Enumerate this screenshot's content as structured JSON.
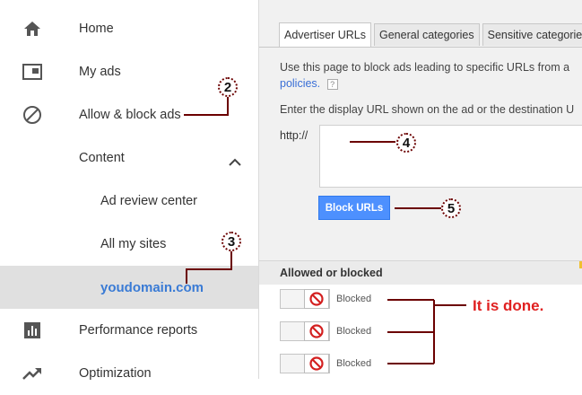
{
  "sidebar": {
    "items": [
      {
        "label": "Home",
        "icon": "home-icon"
      },
      {
        "label": "My ads",
        "icon": "ads-icon"
      },
      {
        "label": "Allow & block ads",
        "icon": "block-icon"
      },
      {
        "label": "Content",
        "icon": "chevron-up-icon"
      },
      {
        "label": "Ad review center"
      },
      {
        "label": "All my sites"
      },
      {
        "label": "youdomain.com"
      },
      {
        "label": "Performance reports",
        "icon": "bar-chart-icon"
      },
      {
        "label": "Optimization",
        "icon": "trending-up-icon"
      }
    ]
  },
  "main": {
    "tabs": [
      "Advertiser URLs",
      "General categories",
      "Sensitive categories"
    ],
    "description": "Use this page to block ads leading to specific URLs from a",
    "policies_link": "policies.",
    "help": "?",
    "instruction": "Enter the display URL shown on the ad or the destination U",
    "url_prefix": "http://",
    "block_button": "Block URLs",
    "table_header": "Allowed or blocked",
    "rows": [
      {
        "status": "Blocked"
      },
      {
        "status": "Blocked"
      },
      {
        "status": "Blocked"
      }
    ]
  },
  "annotations": {
    "markers": [
      "2",
      "3",
      "4",
      "5"
    ],
    "done_text": "It is done."
  },
  "colors": {
    "accent_blue": "#4d90fe",
    "active_link": "#3a7bd5",
    "annotation_line": "#6b0000",
    "annotation_text": "#e02020"
  }
}
